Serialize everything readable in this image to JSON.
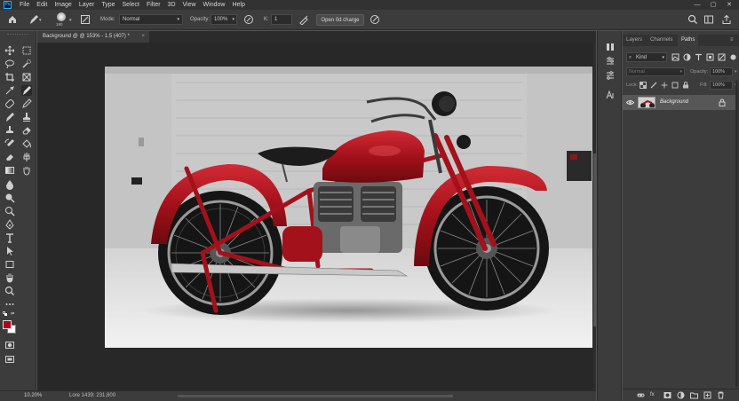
{
  "app": {
    "logo": "Ps",
    "menu": [
      "File",
      "Edit",
      "Image",
      "Layer",
      "Type",
      "Select",
      "Filter",
      "3D",
      "View",
      "Window",
      "Help"
    ],
    "window_controls": [
      "—",
      "▢",
      "✕"
    ]
  },
  "options_bar": {
    "brush_size": "190",
    "mode_label": "Mode:",
    "mode_value": "Normal",
    "opacity_label": "Opacity:",
    "opacity_value": "100%",
    "k_label": "K:",
    "k_value": "1",
    "action_button": "Open 0d charge"
  },
  "document": {
    "tab_title": "Background @ @ 153% - 1.5 (407) *",
    "tab_close": "×"
  },
  "status": {
    "zoom": "10.20%",
    "info": "Lore 1439: 231,800"
  },
  "layers_panel": {
    "tabs": [
      "Layers",
      "Channels",
      "Paths"
    ],
    "active_tab": "Paths",
    "kind": "Kind",
    "blend_mode": "Normal",
    "opacity_label": "Opacity:",
    "opacity_value": "100%",
    "lock_label": "Lock:",
    "fill_label": "Fill:",
    "fill_value": "100%",
    "layers": [
      {
        "name": "Background"
      }
    ]
  },
  "colors": {
    "menubar": "#323232",
    "panel": "#3c3c3c",
    "canvas_bg": "#282828",
    "foreground": "#b3001b",
    "background": "#ffffff",
    "bike_red": "#a3111a"
  },
  "icons": {
    "toolbar": [
      "move-icon",
      "marquee-icon",
      "lasso-icon",
      "quick-select-icon",
      "crop-icon",
      "frame-icon",
      "eyedropper-icon",
      "brush-icon",
      "healing-icon",
      "pencil-icon",
      "stamp-icon",
      "history-brush-icon",
      "eraser-icon",
      "gradient-icon",
      "blur-icon",
      "dodge-icon",
      "pen-icon",
      "type-icon",
      "path-select-icon",
      "shape-icon",
      "hand-icon",
      "zoom-icon",
      "more-icon",
      "color-swatches",
      "quick-mask-icon",
      "screen-mode-icon"
    ]
  }
}
